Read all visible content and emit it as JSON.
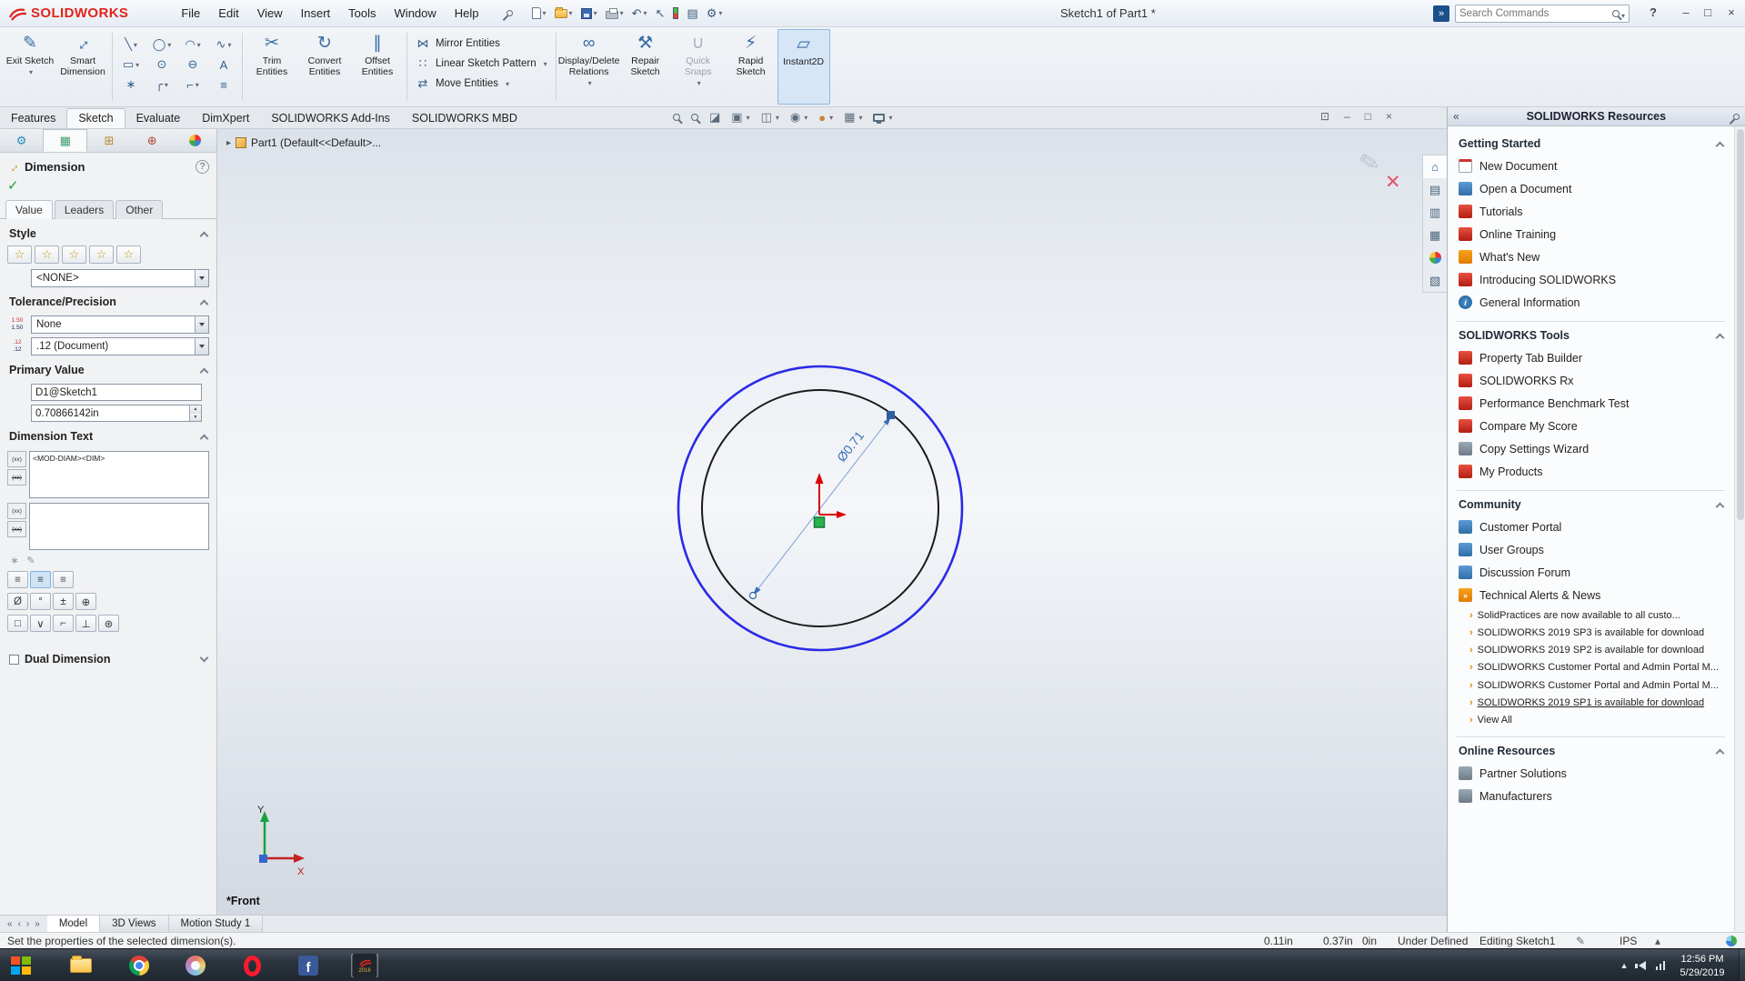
{
  "colors": {
    "brand_red": "#e2231a",
    "selected_sketch_blue": "#2a2ae6",
    "sketch_black": "#1a1a1a",
    "dimension_blue": "#3a6fb8",
    "origin_red": "#dd0000",
    "selected_point_green": "#2ab34f",
    "alert_orange": "#e08a00",
    "taskbar_dark": "#2b333d",
    "facebook_blue": "#3b5998",
    "opera_red": "#ff1b2d"
  },
  "icons": {
    "minimize": "–",
    "maximize": "□",
    "close": "×",
    "restore": "⊡",
    "help": "?",
    "dropdown": "▾",
    "undo": "↶",
    "select": "↖",
    "gear": "⚙",
    "sheet": "▤",
    "search_go": "»",
    "tree_expand": "▸",
    "exit_sketch": "✎",
    "smart_dimension": "↔",
    "line": "╲",
    "circle": "◯",
    "arc": "◠",
    "spline": "∿",
    "rectangle": "▭",
    "slot": "⊙",
    "ellipse": "⊖",
    "text": "A",
    "point": "∗",
    "fillet": "╭",
    "chamfer": "⌐",
    "hatch": "≡",
    "trim": "✂",
    "convert": "↻",
    "offset": "∥",
    "mirror": "⋈",
    "pattern": "∷",
    "move": "⇄",
    "relations": "∞",
    "repair": "⚒",
    "quick_snaps": "∪",
    "rapid": "⚡",
    "instant2d": "▱",
    "check": "✓",
    "x_cancel": "✕",
    "pencil": "✎",
    "zoom_section": "◪",
    "view_cube": "▣",
    "display_style": "◫",
    "hide_show": "◉",
    "appearance": "●",
    "scene": "▦",
    "pm_tab_design": "⚙",
    "pm_tab_property": "▦",
    "pm_tab_config": "⊞",
    "pm_tab_dimxpert": "⊕",
    "star": "☆",
    "home": "⌂",
    "library": "▤",
    "folder": "▥",
    "palette": "▦",
    "props": "▧",
    "collapse": "«",
    "bullet": "›",
    "info": "i",
    "rss": "»",
    "nav_first": "«",
    "nav_prev": "‹",
    "nav_next": "›",
    "nav_last": "»",
    "spin_up": "▲",
    "spin_down": "▼",
    "sym_diameter": "Ø",
    "sym_degree": "°",
    "sym_pm": "±",
    "sym_center": "⊕",
    "justify": "≡",
    "box": "□",
    "vee": "∨",
    "hook": "⌐",
    "perp": "⊥",
    "encircle": "⊛",
    "token": "(xx)",
    "tol": "1.50",
    "prec": ".12",
    "tray_up": "▲",
    "units_up": "▴",
    "fb": "f"
  },
  "titlebar": {
    "brand": "SOLIDWORKS",
    "menus": [
      "File",
      "Edit",
      "View",
      "Insert",
      "Tools",
      "Window",
      "Help"
    ],
    "doc_title": "Sketch1 of Part1 *",
    "search_placeholder": "Search Commands"
  },
  "ribbon": {
    "exit_sketch": "Exit Sketch",
    "smart_dimension": "Smart Dimension",
    "trim": "Trim Entities",
    "convert": "Convert Entities",
    "offset": "Offset Entities",
    "mirror": "Mirror Entities",
    "linear_pattern": "Linear Sketch Pattern",
    "move": "Move Entities",
    "display_delete": "Display/Delete Relations",
    "repair": "Repair Sketch",
    "quick_snaps": "Quick Snaps",
    "rapid": "Rapid Sketch",
    "instant2d": "Instant2D"
  },
  "command_tabs": [
    "Features",
    "Sketch",
    "Evaluate",
    "DimXpert",
    "SOLIDWORKS Add-Ins",
    "SOLIDWORKS MBD"
  ],
  "property_panel": {
    "title": "Dimension",
    "tabs": [
      "Value",
      "Leaders",
      "Other"
    ],
    "style_header": "Style",
    "style_preset": "<NONE>",
    "tolerance_header": "Tolerance/Precision",
    "tolerance_type": "None",
    "tolerance_precision": ".12 (Document)",
    "primary_header": "Primary Value",
    "primary_name": "D1@Sketch1",
    "primary_value": "0.70866142in",
    "dimension_text_header": "Dimension Text",
    "dimension_text_value": "<MOD-DIAM><DIM>",
    "dual_header": "Dual Dimension"
  },
  "viewport": {
    "feature_tree": "Part1 (Default<<Default>...",
    "dimension_label": "Ø0.71",
    "view_orientation": "*Front",
    "axis_x": "X",
    "axis_y": "Y"
  },
  "task_pane": {
    "title": "SOLIDWORKS Resources",
    "sections": [
      {
        "header": "Getting Started",
        "items": [
          "New Document",
          "Open a Document",
          "Tutorials",
          "Online Training",
          "What's New",
          "Introducing SOLIDWORKS",
          "General Information"
        ]
      },
      {
        "header": "SOLIDWORKS Tools",
        "items": [
          "Property Tab Builder",
          "SOLIDWORKS Rx",
          "Performance Benchmark Test",
          "Compare My Score",
          "Copy Settings Wizard",
          "My Products"
        ]
      },
      {
        "header": "Community",
        "items": [
          "Customer Portal",
          "User Groups",
          "Discussion Forum",
          "Technical Alerts & News"
        ],
        "news": [
          "SolidPractices are now available to all custo...",
          "SOLIDWORKS 2019 SP3 is available for download",
          "SOLIDWORKS 2019 SP2 is available for download",
          "SOLIDWORKS Customer Portal and Admin Portal M...",
          "SOLIDWORKS Customer Portal and Admin Portal M...",
          "SOLIDWORKS 2019 SP1 is available for download",
          "View All"
        ]
      },
      {
        "header": "Online Resources",
        "items": [
          "Partner Solutions",
          "Manufacturers"
        ]
      }
    ]
  },
  "bottom_tabs": [
    "Model",
    "3D Views",
    "Motion Study 1"
  ],
  "status_bar": {
    "message": "Set the properties of the selected dimension(s).",
    "x": "0.11in",
    "y": "0.37in",
    "z": "0in",
    "definition": "Under Defined",
    "mode": "Editing Sketch1",
    "units": "IPS"
  },
  "taskbar": {
    "time": "12:56 PM",
    "date": "5/29/2019",
    "app_badge": "2016"
  }
}
